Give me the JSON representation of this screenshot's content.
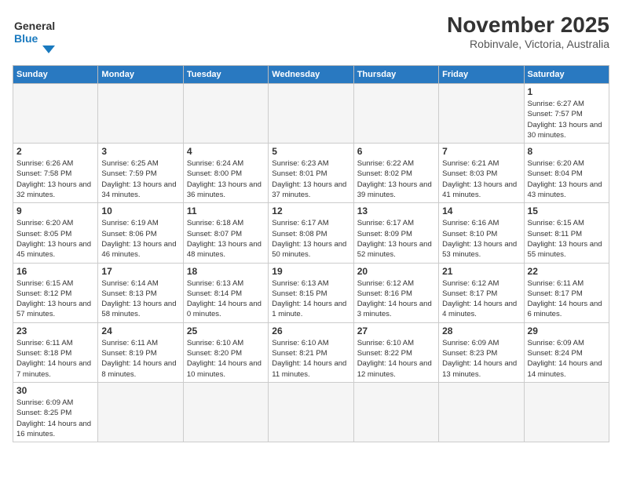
{
  "header": {
    "title": "November 2025",
    "subtitle": "Robinvale, Victoria, Australia",
    "logo_general": "General",
    "logo_blue": "Blue"
  },
  "days_of_week": [
    "Sunday",
    "Monday",
    "Tuesday",
    "Wednesday",
    "Thursday",
    "Friday",
    "Saturday"
  ],
  "weeks": [
    [
      {
        "day": "",
        "info": ""
      },
      {
        "day": "",
        "info": ""
      },
      {
        "day": "",
        "info": ""
      },
      {
        "day": "",
        "info": ""
      },
      {
        "day": "",
        "info": ""
      },
      {
        "day": "",
        "info": ""
      },
      {
        "day": "1",
        "info": "Sunrise: 6:27 AM\nSunset: 7:57 PM\nDaylight: 13 hours and 30 minutes."
      }
    ],
    [
      {
        "day": "2",
        "info": "Sunrise: 6:26 AM\nSunset: 7:58 PM\nDaylight: 13 hours and 32 minutes."
      },
      {
        "day": "3",
        "info": "Sunrise: 6:25 AM\nSunset: 7:59 PM\nDaylight: 13 hours and 34 minutes."
      },
      {
        "day": "4",
        "info": "Sunrise: 6:24 AM\nSunset: 8:00 PM\nDaylight: 13 hours and 36 minutes."
      },
      {
        "day": "5",
        "info": "Sunrise: 6:23 AM\nSunset: 8:01 PM\nDaylight: 13 hours and 37 minutes."
      },
      {
        "day": "6",
        "info": "Sunrise: 6:22 AM\nSunset: 8:02 PM\nDaylight: 13 hours and 39 minutes."
      },
      {
        "day": "7",
        "info": "Sunrise: 6:21 AM\nSunset: 8:03 PM\nDaylight: 13 hours and 41 minutes."
      },
      {
        "day": "8",
        "info": "Sunrise: 6:20 AM\nSunset: 8:04 PM\nDaylight: 13 hours and 43 minutes."
      }
    ],
    [
      {
        "day": "9",
        "info": "Sunrise: 6:20 AM\nSunset: 8:05 PM\nDaylight: 13 hours and 45 minutes."
      },
      {
        "day": "10",
        "info": "Sunrise: 6:19 AM\nSunset: 8:06 PM\nDaylight: 13 hours and 46 minutes."
      },
      {
        "day": "11",
        "info": "Sunrise: 6:18 AM\nSunset: 8:07 PM\nDaylight: 13 hours and 48 minutes."
      },
      {
        "day": "12",
        "info": "Sunrise: 6:17 AM\nSunset: 8:08 PM\nDaylight: 13 hours and 50 minutes."
      },
      {
        "day": "13",
        "info": "Sunrise: 6:17 AM\nSunset: 8:09 PM\nDaylight: 13 hours and 52 minutes."
      },
      {
        "day": "14",
        "info": "Sunrise: 6:16 AM\nSunset: 8:10 PM\nDaylight: 13 hours and 53 minutes."
      },
      {
        "day": "15",
        "info": "Sunrise: 6:15 AM\nSunset: 8:11 PM\nDaylight: 13 hours and 55 minutes."
      }
    ],
    [
      {
        "day": "16",
        "info": "Sunrise: 6:15 AM\nSunset: 8:12 PM\nDaylight: 13 hours and 57 minutes."
      },
      {
        "day": "17",
        "info": "Sunrise: 6:14 AM\nSunset: 8:13 PM\nDaylight: 13 hours and 58 minutes."
      },
      {
        "day": "18",
        "info": "Sunrise: 6:13 AM\nSunset: 8:14 PM\nDaylight: 14 hours and 0 minutes."
      },
      {
        "day": "19",
        "info": "Sunrise: 6:13 AM\nSunset: 8:15 PM\nDaylight: 14 hours and 1 minute."
      },
      {
        "day": "20",
        "info": "Sunrise: 6:12 AM\nSunset: 8:16 PM\nDaylight: 14 hours and 3 minutes."
      },
      {
        "day": "21",
        "info": "Sunrise: 6:12 AM\nSunset: 8:17 PM\nDaylight: 14 hours and 4 minutes."
      },
      {
        "day": "22",
        "info": "Sunrise: 6:11 AM\nSunset: 8:17 PM\nDaylight: 14 hours and 6 minutes."
      }
    ],
    [
      {
        "day": "23",
        "info": "Sunrise: 6:11 AM\nSunset: 8:18 PM\nDaylight: 14 hours and 7 minutes."
      },
      {
        "day": "24",
        "info": "Sunrise: 6:11 AM\nSunset: 8:19 PM\nDaylight: 14 hours and 8 minutes."
      },
      {
        "day": "25",
        "info": "Sunrise: 6:10 AM\nSunset: 8:20 PM\nDaylight: 14 hours and 10 minutes."
      },
      {
        "day": "26",
        "info": "Sunrise: 6:10 AM\nSunset: 8:21 PM\nDaylight: 14 hours and 11 minutes."
      },
      {
        "day": "27",
        "info": "Sunrise: 6:10 AM\nSunset: 8:22 PM\nDaylight: 14 hours and 12 minutes."
      },
      {
        "day": "28",
        "info": "Sunrise: 6:09 AM\nSunset: 8:23 PM\nDaylight: 14 hours and 13 minutes."
      },
      {
        "day": "29",
        "info": "Sunrise: 6:09 AM\nSunset: 8:24 PM\nDaylight: 14 hours and 14 minutes."
      }
    ],
    [
      {
        "day": "30",
        "info": "Sunrise: 6:09 AM\nSunset: 8:25 PM\nDaylight: 14 hours and 16 minutes."
      },
      {
        "day": "",
        "info": ""
      },
      {
        "day": "",
        "info": ""
      },
      {
        "day": "",
        "info": ""
      },
      {
        "day": "",
        "info": ""
      },
      {
        "day": "",
        "info": ""
      },
      {
        "day": "",
        "info": ""
      }
    ]
  ]
}
